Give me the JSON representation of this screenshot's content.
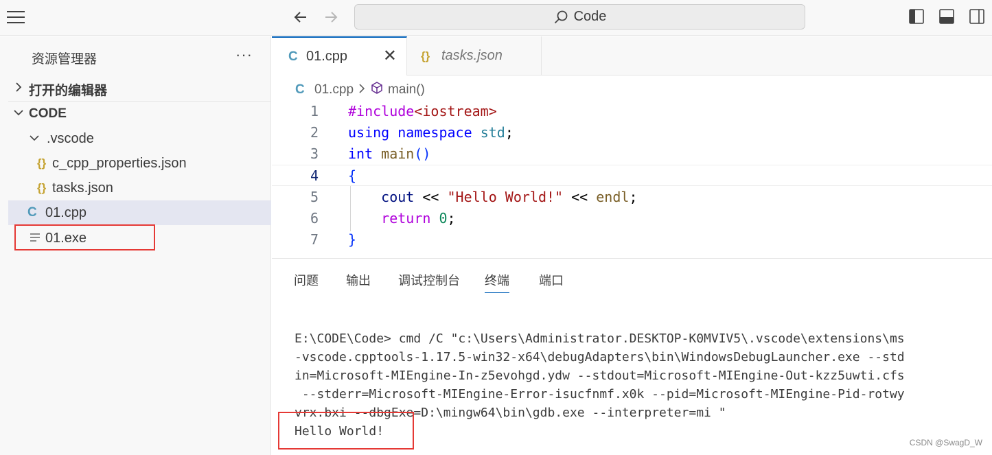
{
  "titlebar": {
    "search_label": "Code"
  },
  "sidebar": {
    "header": "资源管理器",
    "more": "···",
    "open_editors": "打开的编辑器",
    "folder": "CODE",
    "items": [
      {
        "label": ".vscode",
        "type": "folder"
      },
      {
        "label": "c_cpp_properties.json",
        "type": "json"
      },
      {
        "label": "tasks.json",
        "type": "json"
      },
      {
        "label": "01.cpp",
        "type": "cpp"
      },
      {
        "label": "01.exe",
        "type": "binary"
      }
    ]
  },
  "tabs": [
    {
      "label": "01.cpp",
      "icon": "cpp-icon",
      "close": "✕"
    },
    {
      "label": "tasks.json",
      "icon": "json-icon"
    }
  ],
  "breadcrumb": {
    "file": "01.cpp",
    "symbol": "main()"
  },
  "code": {
    "line_numbers": [
      "1",
      "2",
      "3",
      "4",
      "5",
      "6",
      "7"
    ],
    "current_line": 4
  },
  "panel": {
    "tabs": [
      "问题",
      "输出",
      "调试控制台",
      "终端",
      "端口"
    ],
    "active_tab": "终端",
    "terminal_lines": [
      "E:\\CODE\\Code> cmd /C \"c:\\Users\\Administrator.DESKTOP-K0MVIV5\\.vscode\\extensions\\ms",
      "-vscode.cpptools-1.17.5-win32-x64\\debugAdapters\\bin\\WindowsDebugLauncher.exe --std",
      "in=Microsoft-MIEngine-In-z5evohgd.ydw --stdout=Microsoft-MIEngine-Out-kzz5uwti.cfs",
      " --stderr=Microsoft-MIEngine-Error-isucfnmf.x0k --pid=Microsoft-MIEngine-Pid-rotwy",
      "vrx.bxi --dbgExe=D:\\mingw64\\bin\\gdb.exe --interpreter=mi \"",
      "Hello World!"
    ]
  },
  "watermark": "CSDN @SwagD_W",
  "colors": {
    "accent": "#005fb8",
    "highlight_box": "#e53935",
    "json_icon": "#c5a332",
    "cpp_icon": "#519aba"
  }
}
